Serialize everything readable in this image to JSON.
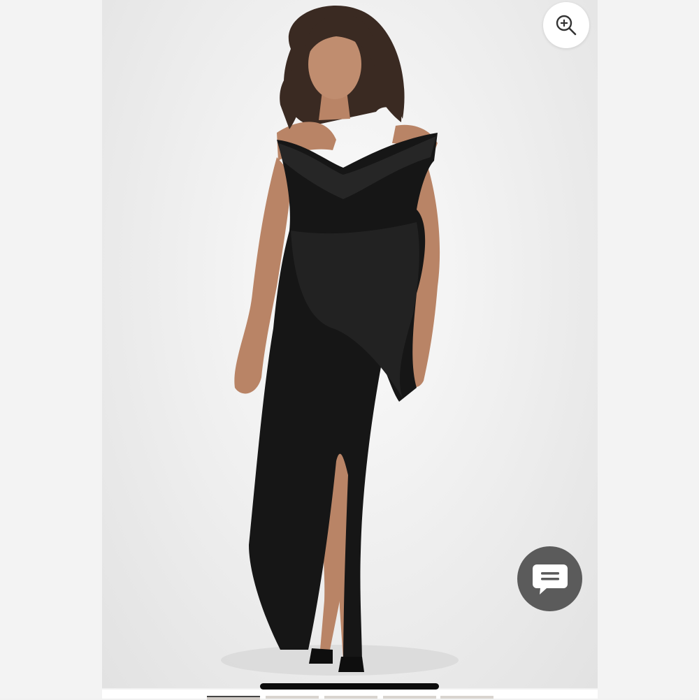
{
  "product_viewer": {
    "image_subject": "model-in-black-off-shoulder-ruffle-maxi-dress",
    "zoom_icon": "zoom-in-icon",
    "chat_icon": "chat-bubble-icon"
  },
  "thumbnails": {
    "count": 5,
    "active_index": 0
  },
  "colors": {
    "dress": "#161616",
    "background": "#ececec",
    "chat_button": "#5b5b5b",
    "zoom_button": "#ffffff"
  }
}
